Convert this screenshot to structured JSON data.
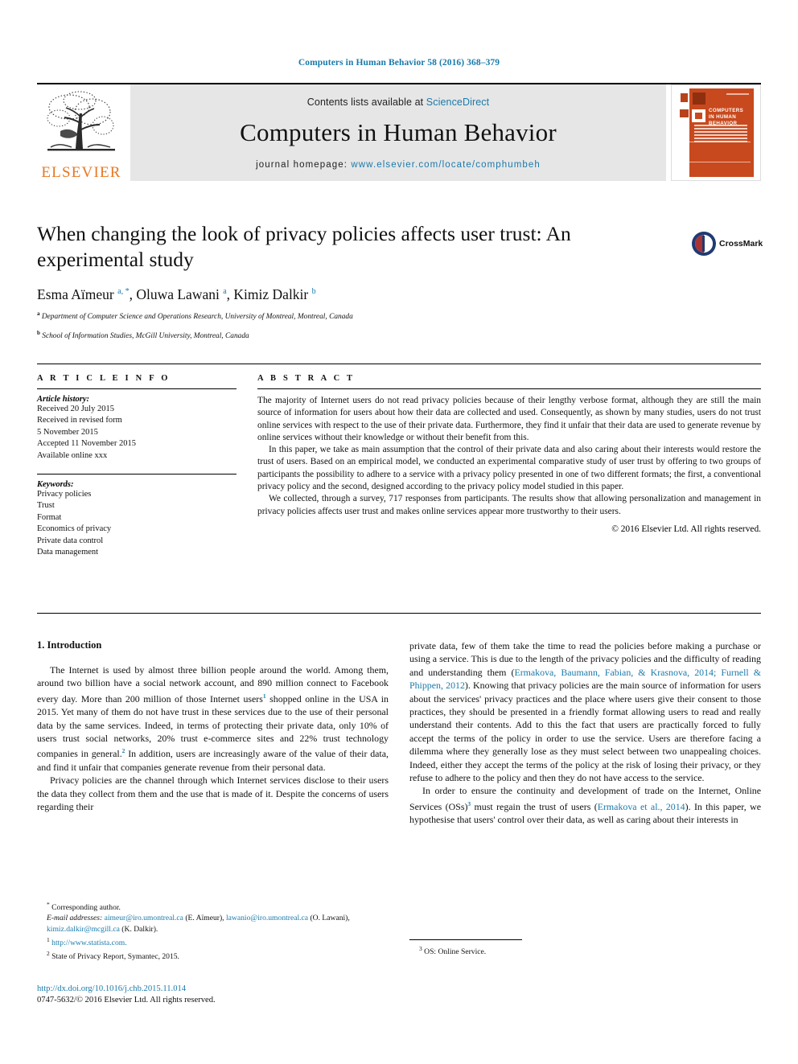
{
  "running_head": "Computers in Human Behavior 58 (2016) 368–379",
  "masthead": {
    "contents_prefix": "Contents lists available at",
    "sciencedirect": "ScienceDirect",
    "journal_title": "Computers in Human Behavior",
    "homepage_label": "journal homepage:",
    "homepage_url": "www.elsevier.com/locate/comphumbeh",
    "publisher": "ELSEVIER",
    "cover_title": "COMPUTERS IN HUMAN BEHAVIOR"
  },
  "article": {
    "title": "When changing the look of privacy policies affects user trust: An experimental study",
    "authors_html": "Esma Aïmeur <sup>a, *</sup>, Oluwa Lawani <sup>a</sup>, Kimiz Dalkir <sup>b</sup>",
    "affiliation_a": "Department of Computer Science and Operations Research, University of Montreal, Montreal, Canada",
    "affiliation_b": "School of Information Studies, McGill University, Montreal, Canada",
    "crossmark_label": "CrossMark"
  },
  "article_info": {
    "heading": "A R T I C L E  I N F O",
    "history_label": "Article history:",
    "history": [
      "Received 20 July 2015",
      "Received in revised form",
      "5 November 2015",
      "Accepted 11 November 2015",
      "Available online xxx"
    ],
    "keywords_label": "Keywords:",
    "keywords": [
      "Privacy policies",
      "Trust",
      "Format",
      "Economics of privacy",
      "Private data control",
      "Data management"
    ]
  },
  "abstract": {
    "heading": "A B S T R A C T",
    "paragraphs": [
      "The majority of Internet users do not read privacy policies because of their lengthy verbose format, although they are still the main source of information for users about how their data are collected and used. Consequently, as shown by many studies, users do not trust online services with respect to the use of their private data. Furthermore, they find it unfair that their data are used to generate revenue by online services without their knowledge or without their benefit from this.",
      "In this paper, we take as main assumption that the control of their private data and also caring about their interests would restore the trust of users. Based on an empirical model, we conducted an experimental comparative study of user trust by offering to two groups of participants the possibility to adhere to a service with a privacy policy presented in one of two different formats; the first, a conventional privacy policy and the second, designed according to the privacy policy model studied in this paper.",
      "We collected, through a survey, 717 responses from participants. The results show that allowing personalization and management in privacy policies affects user trust and makes online services appear more trustworthy to their users."
    ],
    "copyright": "© 2016 Elsevier Ltd. All rights reserved."
  },
  "introduction": {
    "section_number_title": "1. Introduction",
    "left_paragraph_1_pre": "The Internet is used by almost three billion people around the world. Among them, around two billion have a social network account, and 890 million connect to Facebook every day. More than 200 million of those Internet users",
    "left_paragraph_1_sup1": "1",
    "left_paragraph_1_mid": " shopped online in the USA in 2015. Yet many of them do not have trust in these services due to the use of their personal data by the same services. Indeed, in terms of protecting their private data, only 10% of users trust social networks, 20% trust e-commerce sites and 22% trust technology companies in general.",
    "left_paragraph_1_sup2": "2",
    "left_paragraph_1_post": " In addition, users are increasingly aware of the value of their data, and find it unfair that companies generate revenue from their personal data.",
    "left_paragraph_2": "Privacy policies are the channel through which Internet services disclose to their users the data they collect from them and the use that is made of it. Despite the concerns of users regarding their",
    "right_paragraph_1_pre": "private data, few of them take the time to read the policies before making a purchase or using a service. This is due to the length of the privacy policies and the difficulty of reading and understanding them (",
    "right_paragraph_1_cite": "Ermakova, Baumann, Fabian, & Krasnova, 2014; Furnell & Phippen, 2012",
    "right_paragraph_1_post": "). Knowing that privacy policies are the main source of information for users about the services' privacy practices and the place where users give their consent to those practices, they should be presented in a friendly format allowing users to read and really understand their contents. Add to this the fact that users are practically forced to fully accept the terms of the policy in order to use the service. Users are therefore facing a dilemma where they generally lose as they must select between two unappealing choices. Indeed, either they accept the terms of the policy at the risk of losing their privacy, or they refuse to adhere to the policy and then they do not have access to the service.",
    "right_paragraph_2_pre": "In order to ensure the continuity and development of trade on the Internet, Online Services (OSs)",
    "right_paragraph_2_sup": "3",
    "right_paragraph_2_mid": " must regain the trust of users (",
    "right_paragraph_2_cite": "Ermakova et al., 2014",
    "right_paragraph_2_post": "). In this paper, we hypothesise that users' control over their data, as well as caring about their interests in"
  },
  "footnotes": {
    "corresponding_star": "*",
    "corresponding_label": "Corresponding author.",
    "email_label": "E-mail addresses:",
    "email_1": "aimeur@iro.umontreal.ca",
    "email_1_owner": "(E. Aïmeur),",
    "email_2": "lawanio@iro.umontreal.ca",
    "email_2_owner": "(O. Lawani),",
    "email_3": "kimiz.dalkir@mcgill.ca",
    "email_3_owner": "(K. Dalkir).",
    "note_1_sup": "1",
    "note_1": "http://www.statista.com.",
    "note_2_sup": "2",
    "note_2": "State of Privacy Report, Symantec, 2015.",
    "note_3_sup": "3",
    "note_3": "OS: Online Service."
  },
  "footer": {
    "doi": "http://dx.doi.org/10.1016/j.chb.2015.11.014",
    "issn_line": "0747-5632/© 2016 Elsevier Ltd. All rights reserved."
  },
  "colors": {
    "link_blue": "#1a7aab",
    "elsevier_orange": "#E87722",
    "cover_orange": "#c8491d"
  }
}
